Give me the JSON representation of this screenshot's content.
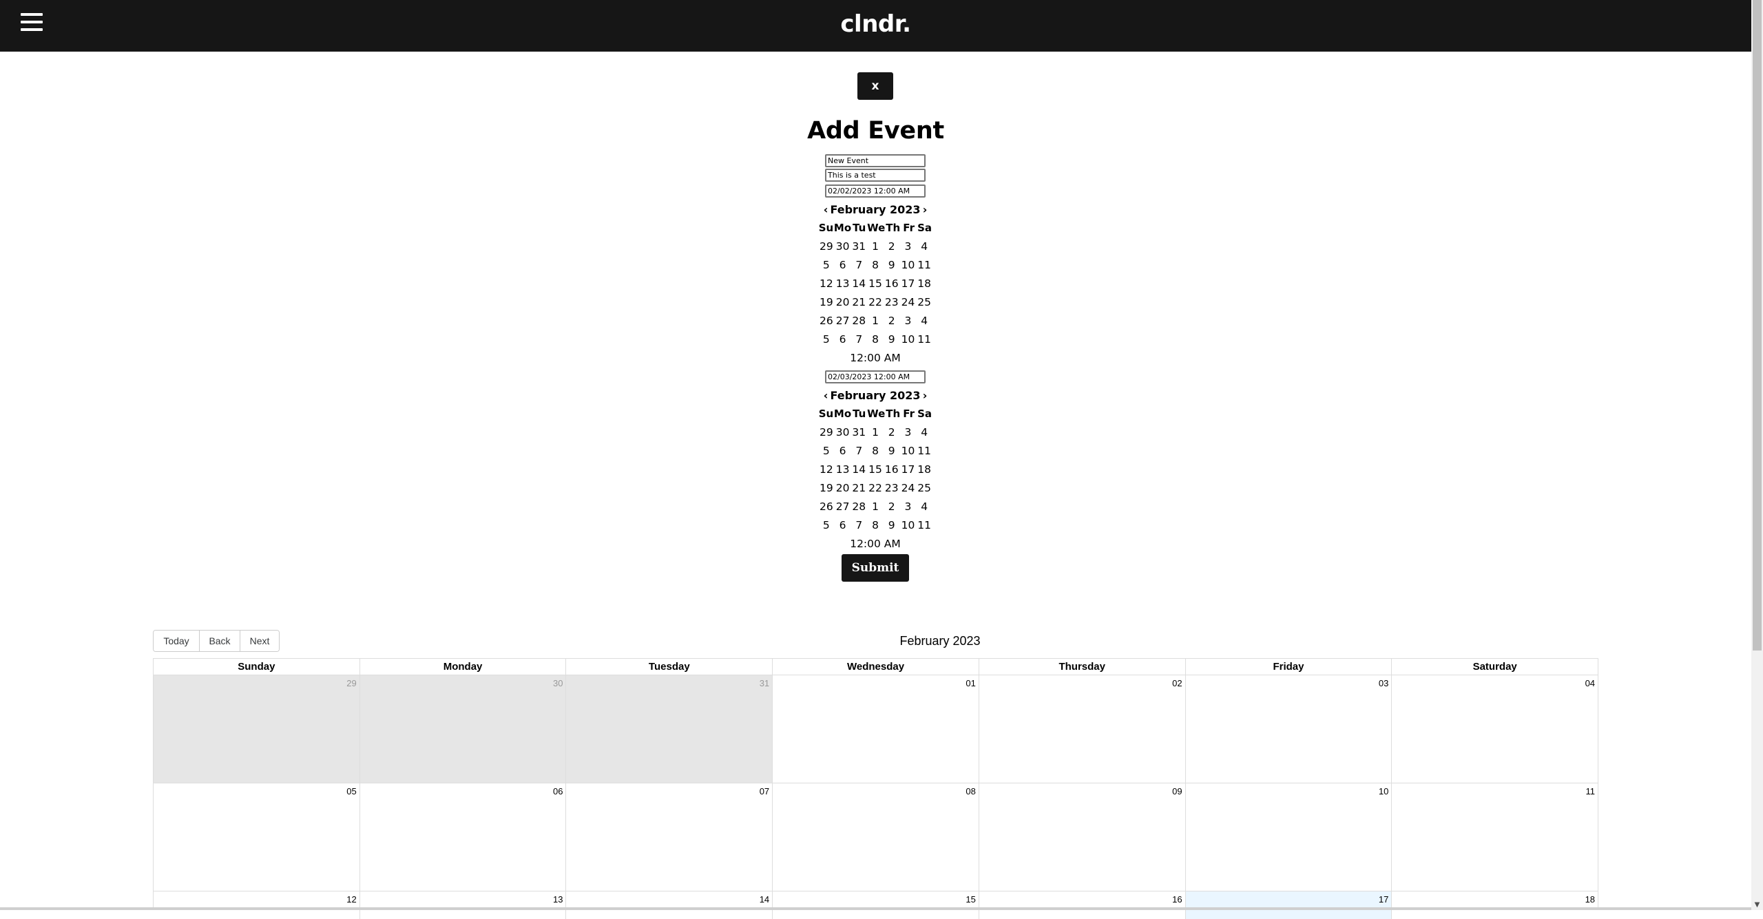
{
  "header": {
    "brand": "clndr.",
    "menu_icon": "hamburger-menu-icon"
  },
  "form": {
    "close_label": "x",
    "title": "Add Event",
    "event_title_value": "New Event",
    "event_desc_value": "This is a test",
    "start": {
      "input_value": "02/02/2023 12:00 AM",
      "month_label": "February 2023",
      "prev": "‹",
      "next": "›",
      "dow": [
        "Su",
        "Mo",
        "Tu",
        "We",
        "Th",
        "Fr",
        "Sa"
      ],
      "weeks": [
        [
          "29",
          "30",
          "31",
          "1",
          "2",
          "3",
          "4"
        ],
        [
          "5",
          "6",
          "7",
          "8",
          "9",
          "10",
          "11"
        ],
        [
          "12",
          "13",
          "14",
          "15",
          "16",
          "17",
          "18"
        ],
        [
          "19",
          "20",
          "21",
          "22",
          "23",
          "24",
          "25"
        ],
        [
          "26",
          "27",
          "28",
          "1",
          "2",
          "3",
          "4"
        ],
        [
          "5",
          "6",
          "7",
          "8",
          "9",
          "10",
          "11"
        ]
      ],
      "time": "12:00 AM"
    },
    "end": {
      "input_value": "02/03/2023 12:00 AM",
      "month_label": "February 2023",
      "prev": "‹",
      "next": "›",
      "dow": [
        "Su",
        "Mo",
        "Tu",
        "We",
        "Th",
        "Fr",
        "Sa"
      ],
      "weeks": [
        [
          "29",
          "30",
          "31",
          "1",
          "2",
          "3",
          "4"
        ],
        [
          "5",
          "6",
          "7",
          "8",
          "9",
          "10",
          "11"
        ],
        [
          "12",
          "13",
          "14",
          "15",
          "16",
          "17",
          "18"
        ],
        [
          "19",
          "20",
          "21",
          "22",
          "23",
          "24",
          "25"
        ],
        [
          "26",
          "27",
          "28",
          "1",
          "2",
          "3",
          "4"
        ],
        [
          "5",
          "6",
          "7",
          "8",
          "9",
          "10",
          "11"
        ]
      ],
      "time": "12:00 AM"
    },
    "submit_label": "Submit"
  },
  "calendar": {
    "toolbar": {
      "today": "Today",
      "back": "Back",
      "next": "Next"
    },
    "label": "February 2023",
    "weekdays": [
      "Sunday",
      "Monday",
      "Tuesday",
      "Wednesday",
      "Thursday",
      "Friday",
      "Saturday"
    ],
    "weeks": [
      [
        {
          "day": "29",
          "off": true
        },
        {
          "day": "30",
          "off": true
        },
        {
          "day": "31",
          "off": true
        },
        {
          "day": "01"
        },
        {
          "day": "02"
        },
        {
          "day": "03"
        },
        {
          "day": "04"
        }
      ],
      [
        {
          "day": "05"
        },
        {
          "day": "06"
        },
        {
          "day": "07"
        },
        {
          "day": "08"
        },
        {
          "day": "09"
        },
        {
          "day": "10"
        },
        {
          "day": "11"
        }
      ],
      [
        {
          "day": "12"
        },
        {
          "day": "13"
        },
        {
          "day": "14"
        },
        {
          "day": "15"
        },
        {
          "day": "16"
        },
        {
          "day": "17",
          "today": true
        },
        {
          "day": "18"
        }
      ]
    ],
    "colors": {
      "off_range_bg": "#e6e6e6",
      "today_bg": "#eaf6ff",
      "header_bg": "#161616"
    }
  }
}
